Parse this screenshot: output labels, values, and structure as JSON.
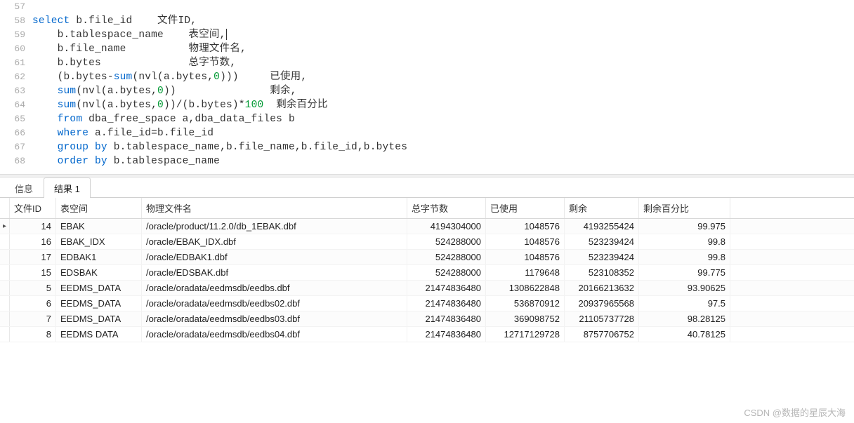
{
  "editor": {
    "lines": [
      {
        "num": "57",
        "tokens": []
      },
      {
        "num": "58",
        "tokens": [
          {
            "c": "kw",
            "t": "select"
          },
          {
            "c": "txt",
            "t": " b.file_id    文件ID,"
          }
        ]
      },
      {
        "num": "59",
        "tokens": [
          {
            "c": "txt",
            "t": "    b.tablespace_name    表空间,"
          },
          {
            "cursor": true
          }
        ]
      },
      {
        "num": "60",
        "tokens": [
          {
            "c": "txt",
            "t": "    b.file_name          物理文件名,"
          }
        ]
      },
      {
        "num": "61",
        "tokens": [
          {
            "c": "txt",
            "t": "    b.bytes              总字节数,"
          }
        ]
      },
      {
        "num": "62",
        "tokens": [
          {
            "c": "txt",
            "t": "    (b.bytes-"
          },
          {
            "c": "kw",
            "t": "sum"
          },
          {
            "c": "txt",
            "t": "(nvl(a.bytes,"
          },
          {
            "c": "num",
            "t": "0"
          },
          {
            "c": "txt",
            "t": ")))     已使用,"
          }
        ]
      },
      {
        "num": "63",
        "tokens": [
          {
            "c": "txt",
            "t": "    "
          },
          {
            "c": "kw",
            "t": "sum"
          },
          {
            "c": "txt",
            "t": "(nvl(a.bytes,"
          },
          {
            "c": "num",
            "t": "0"
          },
          {
            "c": "txt",
            "t": "))               剩余,"
          }
        ]
      },
      {
        "num": "64",
        "tokens": [
          {
            "c": "txt",
            "t": "    "
          },
          {
            "c": "kw",
            "t": "sum"
          },
          {
            "c": "txt",
            "t": "(nvl(a.bytes,"
          },
          {
            "c": "num",
            "t": "0"
          },
          {
            "c": "txt",
            "t": "))/(b.bytes)*"
          },
          {
            "c": "num",
            "t": "100"
          },
          {
            "c": "txt",
            "t": "  剩余百分比"
          }
        ]
      },
      {
        "num": "65",
        "tokens": [
          {
            "c": "txt",
            "t": "    "
          },
          {
            "c": "kw",
            "t": "from"
          },
          {
            "c": "txt",
            "t": " dba_free_space a,dba_data_files b"
          }
        ]
      },
      {
        "num": "66",
        "tokens": [
          {
            "c": "txt",
            "t": "    "
          },
          {
            "c": "kw",
            "t": "where"
          },
          {
            "c": "txt",
            "t": " a.file_id=b.file_id"
          }
        ]
      },
      {
        "num": "67",
        "tokens": [
          {
            "c": "txt",
            "t": "    "
          },
          {
            "c": "kw",
            "t": "group"
          },
          {
            "c": "txt",
            "t": " "
          },
          {
            "c": "kw",
            "t": "by"
          },
          {
            "c": "txt",
            "t": " b.tablespace_name,b.file_name,b.file_id,b.bytes"
          }
        ]
      },
      {
        "num": "68",
        "tokens": [
          {
            "c": "txt",
            "t": "    "
          },
          {
            "c": "kw",
            "t": "order"
          },
          {
            "c": "txt",
            "t": " "
          },
          {
            "c": "kw",
            "t": "by"
          },
          {
            "c": "txt",
            "t": " b.tablespace_name"
          }
        ]
      }
    ]
  },
  "tabs": {
    "info": "信息",
    "result": "结果 1"
  },
  "grid": {
    "headers": {
      "id": "文件ID",
      "ts": "表空间",
      "fn": "物理文件名",
      "tb": "总字节数",
      "us": "已使用",
      "fr": "剩余",
      "pc": "剩余百分比"
    },
    "rows": [
      {
        "ind": "▸",
        "id": "14",
        "ts": "EBAK",
        "fn": "/oracle/product/11.2.0/db_1EBAK.dbf",
        "tb": "4194304000",
        "us": "1048576",
        "fr": "4193255424",
        "pc": "99.975"
      },
      {
        "ind": "",
        "id": "16",
        "ts": "EBAK_IDX",
        "fn": "/oracle/EBAK_IDX.dbf",
        "tb": "524288000",
        "us": "1048576",
        "fr": "523239424",
        "pc": "99.8"
      },
      {
        "ind": "",
        "id": "17",
        "ts": "EDBAK1",
        "fn": "/oracle/EDBAK1.dbf",
        "tb": "524288000",
        "us": "1048576",
        "fr": "523239424",
        "pc": "99.8"
      },
      {
        "ind": "",
        "id": "15",
        "ts": "EDSBAK",
        "fn": "/oracle/EDSBAK.dbf",
        "tb": "524288000",
        "us": "1179648",
        "fr": "523108352",
        "pc": "99.775"
      },
      {
        "ind": "",
        "id": "5",
        "ts": "EEDMS_DATA",
        "fn": "/oracle/oradata/eedmsdb/eedbs.dbf",
        "tb": "21474836480",
        "us": "1308622848",
        "fr": "20166213632",
        "pc": "93.90625"
      },
      {
        "ind": "",
        "id": "6",
        "ts": "EEDMS_DATA",
        "fn": "/oracle/oradata/eedmsdb/eedbs02.dbf",
        "tb": "21474836480",
        "us": "536870912",
        "fr": "20937965568",
        "pc": "97.5"
      },
      {
        "ind": "",
        "id": "7",
        "ts": "EEDMS_DATA",
        "fn": "/oracle/oradata/eedmsdb/eedbs03.dbf",
        "tb": "21474836480",
        "us": "369098752",
        "fr": "21105737728",
        "pc": "98.28125"
      },
      {
        "ind": "",
        "id": "8",
        "ts": "EEDMS DATA",
        "fn": "/oracle/oradata/eedmsdb/eedbs04.dbf",
        "tb": "21474836480",
        "us": "12717129728",
        "fr": "8757706752",
        "pc": "40.78125"
      }
    ]
  },
  "watermark": "CSDN @数据的星辰大海"
}
